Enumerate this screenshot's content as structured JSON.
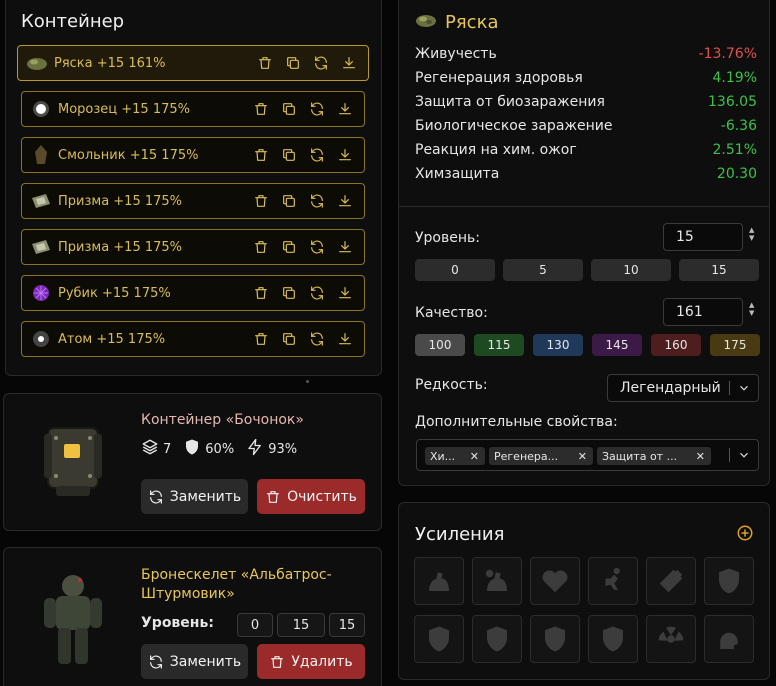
{
  "container_panel": {
    "title": "Контейнер",
    "artifacts": [
      {
        "label": "Ряска +15 161%",
        "icon": "ryaska-artifact-icon",
        "active": true
      },
      {
        "label": "Морозец +15 175%",
        "icon": "morozets-artifact-icon"
      },
      {
        "label": "Смольник +15 175%",
        "icon": "smolnik-artifact-icon"
      },
      {
        "label": "Призма +15 175%",
        "icon": "prism-artifact-icon"
      },
      {
        "label": "Призма +15 175%",
        "icon": "prism-artifact-icon"
      },
      {
        "label": "Рубик +15 175%",
        "icon": "rubik-artifact-icon"
      },
      {
        "label": "Атом +15 175%",
        "icon": "atom-artifact-icon"
      }
    ],
    "row_action_icons": [
      "trash-icon",
      "copy-icon",
      "swap-icon",
      "download-icon"
    ]
  },
  "container_card": {
    "name": "Контейнер «Бочонок»",
    "slots": "7",
    "protection": "60%",
    "efficiency": "93%",
    "replace_label": "Заменить",
    "clear_label": "Очистить"
  },
  "armor_card": {
    "name": "Бронескелет «Альбатрос-Штурмовик»",
    "level_label": "Уровень:",
    "level_values": [
      "0",
      "15",
      "15"
    ],
    "replace_label": "Заменить",
    "delete_label": "Удалить"
  },
  "details_panel": {
    "title": "Ряска",
    "stats": [
      {
        "name": "Живучесть",
        "value": "-13.76%",
        "sign": "neg"
      },
      {
        "name": "Регенерация здоровья",
        "value": "4.19%",
        "sign": "pos"
      },
      {
        "name": "Защита от биозаражения",
        "value": "136.05",
        "sign": "pos"
      },
      {
        "name": "Биологическое заражение",
        "value": "-6.36",
        "sign": "pos"
      },
      {
        "name": "Реакция на хим. ожог",
        "value": "2.51%",
        "sign": "pos"
      },
      {
        "name": "Химзащита",
        "value": "20.30",
        "sign": "pos"
      }
    ],
    "level": {
      "label": "Уровень:",
      "value": "15",
      "presets": [
        "0",
        "5",
        "10",
        "15"
      ]
    },
    "quality": {
      "label": "Качество:",
      "value": "161",
      "presets": [
        {
          "label": "100",
          "color": "#4a4a4a"
        },
        {
          "label": "115",
          "color": "#1e4a22"
        },
        {
          "label": "130",
          "color": "#20385a"
        },
        {
          "label": "145",
          "color": "#3c1a48"
        },
        {
          "label": "160",
          "color": "#4e1e1e"
        },
        {
          "label": "175",
          "color": "#4a3a12"
        }
      ]
    },
    "rarity": {
      "label": "Редкость:",
      "value": "Легендарный"
    },
    "extra": {
      "label": "Дополнительные свойства:",
      "tags": [
        "Хи...",
        "Регенера...",
        "Защита от ..."
      ]
    }
  },
  "boosts_panel": {
    "title": "Усиления",
    "icons": [
      "strength-boost-icon",
      "healing-boost-icon",
      "health-plus-icon",
      "sprint-icon",
      "bandage-icon",
      "shield-icon",
      "thermal-protection-icon",
      "radiation-protection-icon",
      "bio-protection-icon",
      "psy-protection-icon",
      "radiation-reduction-icon",
      "psy-reduction-icon"
    ]
  },
  "colors": {
    "accent": "#d9bd5a",
    "danger": "#9b2a2a",
    "positive": "#3ec04b",
    "negative": "#e05050",
    "add_icon": "#e0a020"
  }
}
